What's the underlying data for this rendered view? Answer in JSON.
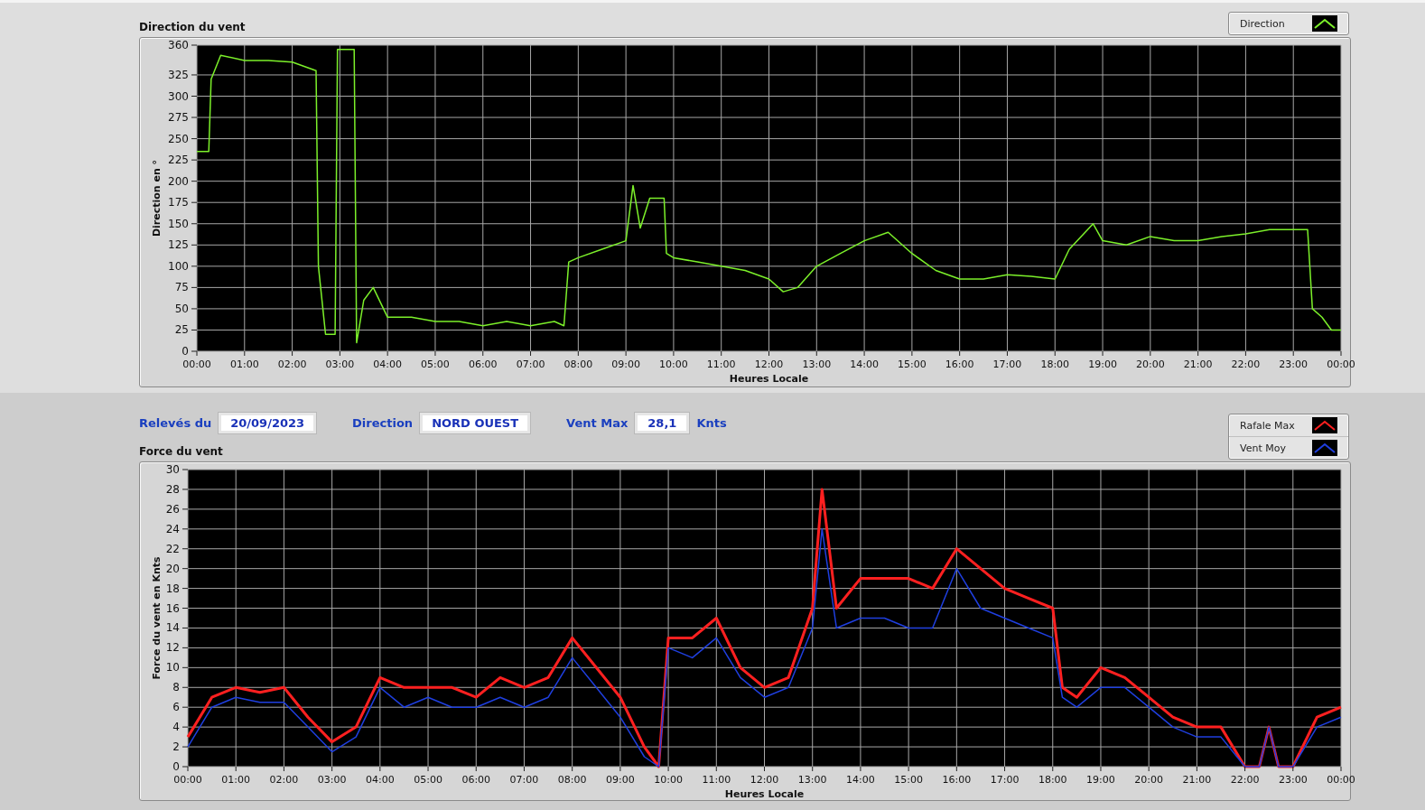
{
  "direction_chart": {
    "title": "Direction du vent",
    "chart_data": {
      "type": "line",
      "grid": true,
      "xlabel": "Heures Locale",
      "ylabel": "Direction en °",
      "xlim": [
        0,
        24
      ],
      "ylim": [
        0,
        360
      ],
      "x": [
        0,
        0.25,
        0.3,
        0.5,
        1,
        1.5,
        2,
        2.5,
        2.55,
        2.7,
        2.9,
        2.95,
        3.3,
        3.35,
        3.5,
        3.7,
        4,
        4.5,
        5,
        5.5,
        6,
        6.5,
        7,
        7.5,
        7.7,
        7.8,
        8,
        8.5,
        9,
        9.15,
        9.3,
        9.5,
        9.8,
        9.85,
        10,
        10.5,
        11,
        11.5,
        12,
        12.3,
        12.6,
        13,
        13.5,
        14,
        14.5,
        15,
        15.5,
        16,
        16.5,
        17,
        17.5,
        18,
        18.3,
        18.8,
        19,
        19.5,
        20,
        20.5,
        21,
        21.5,
        22,
        22.5,
        23,
        23.3,
        23.4,
        23.6,
        23.8,
        24
      ],
      "series": [
        {
          "name": "Direction",
          "color": "#7cf02a",
          "values": [
            235,
            235,
            320,
            348,
            342,
            342,
            340,
            330,
            100,
            20,
            20,
            355,
            355,
            10,
            60,
            75,
            40,
            40,
            35,
            35,
            30,
            35,
            30,
            35,
            30,
            105,
            110,
            120,
            130,
            195,
            145,
            180,
            180,
            115,
            110,
            105,
            100,
            95,
            85,
            70,
            75,
            100,
            115,
            130,
            140,
            115,
            95,
            85,
            85,
            90,
            88,
            85,
            120,
            150,
            130,
            125,
            135,
            130,
            130,
            135,
            138,
            143,
            143,
            143,
            50,
            40,
            25,
            25
          ]
        }
      ],
      "yticks": [
        0,
        25,
        50,
        75,
        100,
        125,
        150,
        175,
        200,
        225,
        250,
        275,
        300,
        325,
        360
      ],
      "xticks": [
        {
          "value": 0,
          "label": "00:00"
        },
        {
          "value": 1,
          "label": "01:00"
        },
        {
          "value": 2,
          "label": "02:00"
        },
        {
          "value": 3,
          "label": "03:00"
        },
        {
          "value": 4,
          "label": "04:00"
        },
        {
          "value": 5,
          "label": "05:00"
        },
        {
          "value": 6,
          "label": "06:00"
        },
        {
          "value": 7,
          "label": "07:00"
        },
        {
          "value": 8,
          "label": "08:00"
        },
        {
          "value": 9,
          "label": "09:00"
        },
        {
          "value": 10,
          "label": "10:00"
        },
        {
          "value": 11,
          "label": "11:00"
        },
        {
          "value": 12,
          "label": "12:00"
        },
        {
          "value": 13,
          "label": "13:00"
        },
        {
          "value": 14,
          "label": "14:00"
        },
        {
          "value": 15,
          "label": "15:00"
        },
        {
          "value": 16,
          "label": "16:00"
        },
        {
          "value": 17,
          "label": "17:00"
        },
        {
          "value": 18,
          "label": "18:00"
        },
        {
          "value": 19,
          "label": "19:00"
        },
        {
          "value": 20,
          "label": "20:00"
        },
        {
          "value": 21,
          "label": "21:00"
        },
        {
          "value": 22,
          "label": "22:00"
        },
        {
          "value": 23,
          "label": "23:00"
        },
        {
          "value": 24,
          "label": "00:00"
        }
      ]
    }
  },
  "readings": [
    {
      "label": "Relevés du",
      "value": "20/09/2023"
    },
    {
      "label": "Direction",
      "value": "NORD OUEST"
    },
    {
      "label": "Vent Max",
      "value": "28,1",
      "unit": "Knts"
    }
  ],
  "force_chart": {
    "title": "Force du vent",
    "chart_data": {
      "type": "line",
      "grid": true,
      "xlabel": "Heures Locale",
      "ylabel": "Force du vent en Knts",
      "xlim": [
        0,
        24
      ],
      "ylim": [
        0,
        30
      ],
      "x": [
        0,
        0.5,
        1,
        1.5,
        2,
        2.5,
        3,
        3.5,
        4,
        4.5,
        5,
        5.5,
        6,
        6.5,
        7,
        7.5,
        8,
        8.5,
        9,
        9.5,
        9.8,
        10,
        10.5,
        11,
        11.5,
        12,
        12.5,
        13,
        13.2,
        13.5,
        14,
        14.5,
        15,
        15.5,
        16,
        16.5,
        17,
        17.5,
        18,
        18.2,
        18.5,
        19,
        19.5,
        20,
        20.5,
        21,
        21.5,
        22,
        22.3,
        22.5,
        22.7,
        23,
        23.5,
        24
      ],
      "series": [
        {
          "name": "Rafale Max",
          "color": "#ff2020",
          "values": [
            3,
            7,
            8,
            7.5,
            8,
            5,
            2.5,
            4,
            9,
            8,
            8,
            8,
            7,
            9,
            8,
            9,
            13,
            10,
            7,
            2,
            0,
            13,
            13,
            15,
            10,
            8,
            9,
            16,
            28,
            16,
            19,
            19,
            19,
            18,
            22,
            20,
            18,
            17,
            16,
            8,
            7,
            10,
            9,
            7,
            5,
            4,
            4,
            0,
            0,
            4,
            0,
            0,
            5,
            6
          ]
        },
        {
          "name": "Vent Moy",
          "color": "#1f3fe0",
          "values": [
            2,
            6,
            7,
            6.5,
            6.5,
            4,
            1.5,
            3,
            8,
            6,
            7,
            6,
            6,
            7,
            6,
            7,
            11,
            8,
            5,
            1,
            0,
            12,
            11,
            13,
            9,
            7,
            8,
            14,
            24,
            14,
            15,
            15,
            14,
            14,
            20,
            16,
            15,
            14,
            13,
            7,
            6,
            8,
            8,
            6,
            4,
            3,
            3,
            0,
            0,
            4,
            0,
            0,
            4,
            5
          ]
        }
      ],
      "yticks": [
        0,
        2,
        4,
        6,
        8,
        10,
        12,
        14,
        16,
        18,
        20,
        22,
        24,
        26,
        28,
        30
      ],
      "xticks": [
        {
          "value": 0,
          "label": "00:00"
        },
        {
          "value": 1,
          "label": "01:00"
        },
        {
          "value": 2,
          "label": "02:00"
        },
        {
          "value": 3,
          "label": "03:00"
        },
        {
          "value": 4,
          "label": "04:00"
        },
        {
          "value": 5,
          "label": "05:00"
        },
        {
          "value": 6,
          "label": "06:00"
        },
        {
          "value": 7,
          "label": "07:00"
        },
        {
          "value": 8,
          "label": "08:00"
        },
        {
          "value": 9,
          "label": "09:00"
        },
        {
          "value": 10,
          "label": "10:00"
        },
        {
          "value": 11,
          "label": "11:00"
        },
        {
          "value": 12,
          "label": "12:00"
        },
        {
          "value": 13,
          "label": "13:00"
        },
        {
          "value": 14,
          "label": "14:00"
        },
        {
          "value": 15,
          "label": "15:00"
        },
        {
          "value": 16,
          "label": "16:00"
        },
        {
          "value": 17,
          "label": "17:00"
        },
        {
          "value": 18,
          "label": "18:00"
        },
        {
          "value": 19,
          "label": "19:00"
        },
        {
          "value": 20,
          "label": "20:00"
        },
        {
          "value": 21,
          "label": "21:00"
        },
        {
          "value": 22,
          "label": "22:00"
        },
        {
          "value": 23,
          "label": "23:00"
        },
        {
          "value": 24,
          "label": "00:00"
        }
      ]
    }
  }
}
